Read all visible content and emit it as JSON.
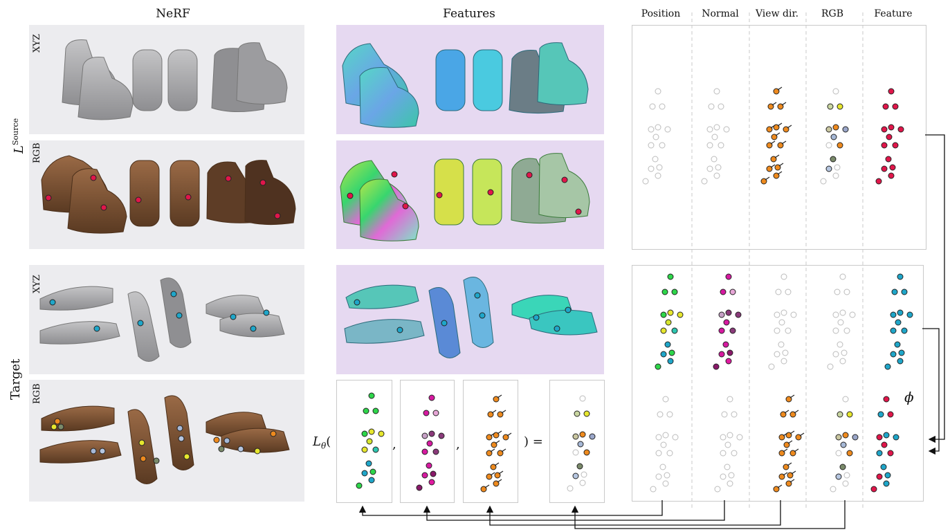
{
  "headers": {
    "nerf": "NeRF",
    "features": "Features"
  },
  "columns": [
    "Position",
    "Normal",
    "View dir.",
    "RGB",
    "Feature"
  ],
  "row_labels": {
    "source": "L",
    "source_sup": "Source",
    "target": "Target",
    "xyz": "XYZ",
    "rgb": "RGB"
  },
  "formula": {
    "left": "L",
    "sub": "θ",
    "open": "(",
    "comma1": ",",
    "comma2": ",",
    "close_eq": ") ="
  },
  "phi": "ϕ",
  "colors": {
    "marker_red": "#e0164a",
    "marker_blue": "#1fa6c9",
    "marker_orange": "#ee8a1e",
    "panel_gray": "#ececef",
    "panel_purple": "#e6d9f1",
    "shoe_brown": "#7a5236"
  }
}
